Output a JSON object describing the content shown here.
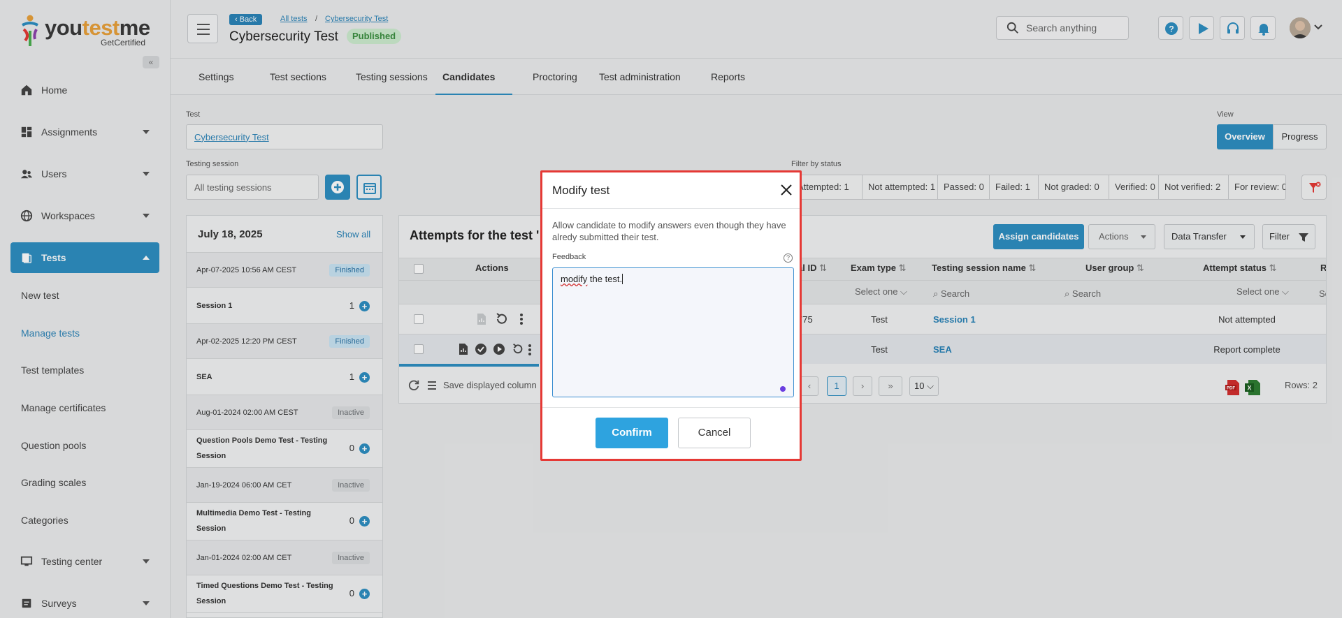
{
  "brand": {
    "name_a": "you",
    "name_b": "test",
    "name_c": "me",
    "sub": "GetCertified"
  },
  "sidebar": {
    "items": [
      {
        "label": "Home"
      },
      {
        "label": "Assignments"
      },
      {
        "label": "Users"
      },
      {
        "label": "Workspaces"
      },
      {
        "label": "Tests"
      },
      {
        "label": "Testing center"
      },
      {
        "label": "Surveys"
      }
    ],
    "subitems": [
      "New test",
      "Manage tests",
      "Test templates",
      "Manage certificates",
      "Question pools",
      "Grading scales",
      "Categories"
    ]
  },
  "header": {
    "back_label": "Back",
    "breadcrumb": [
      "All tests",
      "/",
      "Cybersecurity Test"
    ],
    "title": "Cybersecurity Test",
    "status": "Published",
    "search_placeholder": "Search anything"
  },
  "tabs": [
    "Settings",
    "Test sections",
    "Testing sessions",
    "Candidates",
    "Proctoring",
    "Test administration",
    "Reports"
  ],
  "filters": {
    "test_label": "Test",
    "test_value": "Cybersecurity Test",
    "session_label": "Testing session",
    "session_placeholder": "All testing sessions",
    "view_label": "View",
    "view_options": [
      "Overview",
      "Progress"
    ],
    "status_label": "Filter by status",
    "status_chips": [
      "Attempted: 1",
      "Not attempted: 1",
      "Passed: 0",
      "Failed: 1",
      "Not graded: 0",
      "Verified: 0",
      "Not verified: 2",
      "For review: 0"
    ]
  },
  "sessions": {
    "date": "July 18, 2025",
    "show_all": "Show all",
    "entries": [
      {
        "datetime": "Apr-07-2025 10:56 AM CEST",
        "status": "Finished",
        "name": "Session 1",
        "count": "1"
      },
      {
        "datetime": "Apr-02-2025 12:20 PM CEST",
        "status": "Finished",
        "name": "SEA",
        "count": "1"
      },
      {
        "datetime": "Aug-01-2024 02:00 AM CEST",
        "status": "Inactive",
        "name": "Question Pools Demo Test - Testing Session",
        "count": "0"
      },
      {
        "datetime": "Jan-19-2024 06:00 AM CET",
        "status": "Inactive",
        "name": "Multimedia Demo Test - Testing Session",
        "count": "0"
      },
      {
        "datetime": "Jan-01-2024 02:00 AM CET",
        "status": "Inactive",
        "name": "Timed Questions Demo Test - Testing Session",
        "count": "0"
      }
    ]
  },
  "attempts": {
    "title": "Attempts for the test '",
    "assign_label": "Assign candidates",
    "actions_label": "Actions",
    "data_transfer_label": "Data Transfer",
    "filter_label": "Filter",
    "columns": {
      "actions": "Actions",
      "id": "al ID",
      "exam_type": "Exam type",
      "session_name": "Testing session name",
      "user_group": "User group",
      "attempt_status": "Attempt status",
      "last": "R"
    },
    "select_one": "Select one",
    "search_ph": "Search",
    "search_cut": "Se",
    "rows": [
      {
        "id": "775",
        "exam_type": "Test",
        "session": "Session 1",
        "status": "Not attempted"
      },
      {
        "id": "",
        "exam_type": "Test",
        "session": "SEA",
        "status": "Report complete"
      }
    ],
    "save_cols": "Save displayed column",
    "page": "1",
    "per_page": "10",
    "rows_count": "Rows: 2"
  },
  "modal": {
    "title": "Modify test",
    "description": "Allow candidate to modify answers even though they have alredy submitted their test.",
    "feedback_label": "Feedback",
    "feedback_word": "modify",
    "feedback_rest": " the test.",
    "confirm": "Confirm",
    "cancel": "Cancel"
  },
  "colors": {
    "primary": "#2e8fc2",
    "modal_border": "#e53935",
    "confirm": "#2ea3df"
  }
}
